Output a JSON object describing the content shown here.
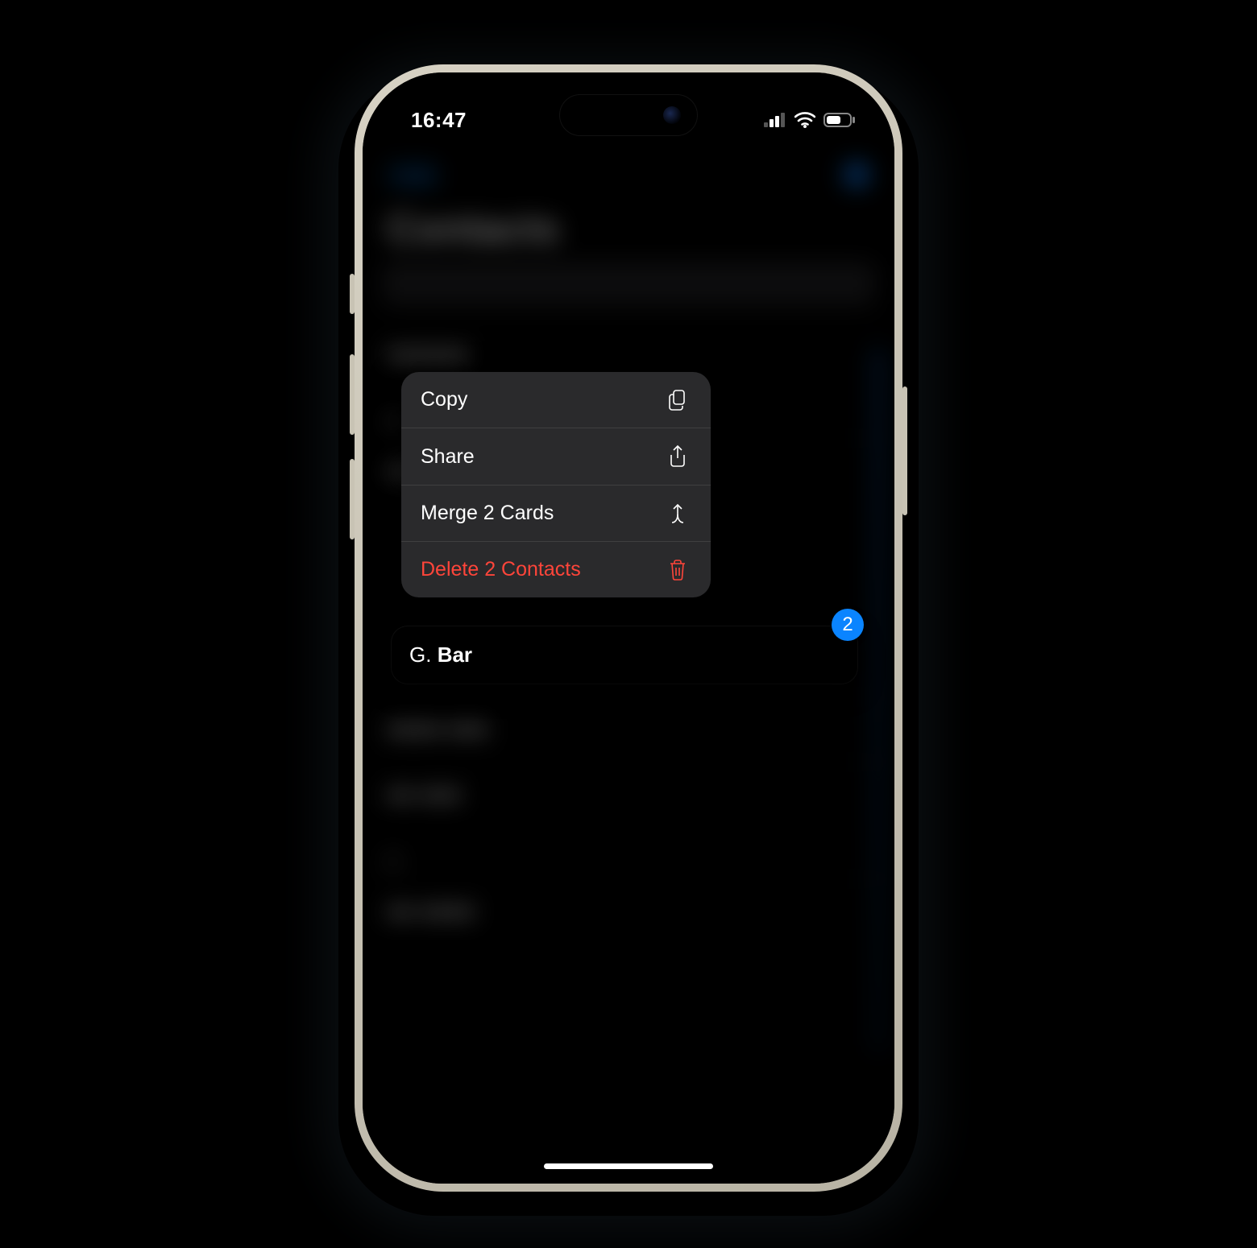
{
  "status": {
    "time": "16:47"
  },
  "nav": {
    "back_label": "Lists",
    "title": "Contacts"
  },
  "menu": {
    "copy": "Copy",
    "share": "Share",
    "merge": "Merge 2 Cards",
    "delete": "Delete 2 Contacts"
  },
  "preview": {
    "first": "G.",
    "last": "Bar",
    "badge": "2"
  },
  "bg_rows": {
    "r1": "■■■■■■",
    "h1": "B",
    "r2": "■■■■ ■■■",
    "r3": "■■ ■■■",
    "h2": "C",
    "r4": "■■ ■■■■"
  }
}
